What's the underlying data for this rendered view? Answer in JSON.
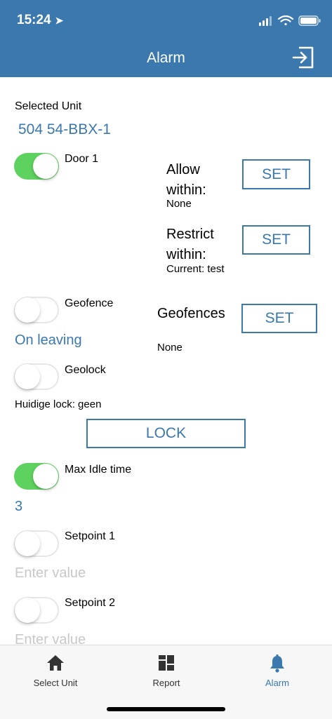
{
  "status": {
    "time": "15:24"
  },
  "header": {
    "title": "Alarm"
  },
  "unit": {
    "label": "Selected Unit",
    "value": "504 54-BBX-1"
  },
  "door": {
    "label": "Door 1",
    "on": true,
    "allow_label": "Allow within:",
    "allow_value": "None",
    "allow_button": "SET",
    "restrict_label": "Restrict within:",
    "restrict_value": "Current: test",
    "restrict_button": "SET"
  },
  "geofence": {
    "label": "Geofence",
    "on": false,
    "mode": "On leaving",
    "geofences_label": "Geofences",
    "geofences_value": "None",
    "geofences_button": "SET"
  },
  "geolock": {
    "label": "Geolock",
    "on": false,
    "current": "Huidige lock: geen",
    "button": "LOCK"
  },
  "max_idle": {
    "label": "Max Idle time",
    "on": true,
    "value": "3"
  },
  "setpoint1": {
    "label": "Setpoint 1",
    "on": false,
    "placeholder": "Enter value"
  },
  "setpoint2": {
    "label": "Setpoint 2",
    "on": false,
    "placeholder": "Enter value"
  },
  "tabs": [
    {
      "label": "Select Unit",
      "icon": "home-icon",
      "active": false
    },
    {
      "label": "Report",
      "icon": "grid-icon",
      "active": false
    },
    {
      "label": "Alarm",
      "icon": "bell-icon",
      "active": true
    }
  ],
  "colors": {
    "brand": "#3a78ad",
    "toggle_on": "#5dd25e",
    "placeholder": "#c8c8c8"
  }
}
